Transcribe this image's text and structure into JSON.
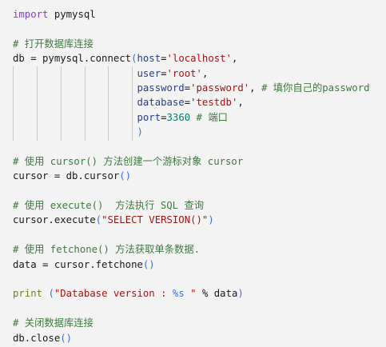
{
  "colors": {
    "background": "#f3f3f3",
    "keyword": "#8a3fc0",
    "comment": "#3f7a3f",
    "string": "#a31515",
    "parameter": "#2a3d8f",
    "number": "#0b7d66",
    "bracket": "#3b6fe0",
    "builtin": "#7a7a28"
  },
  "code": {
    "lines": [
      [
        [
          "kw",
          "import"
        ],
        [
          "tx",
          " pymysql"
        ]
      ],
      [],
      [
        [
          "cm",
          "# 打开数据库连接"
        ]
      ],
      [
        [
          "tx",
          "db = pymysql.connect"
        ],
        [
          "br",
          "("
        ],
        [
          "par",
          "host"
        ],
        [
          "tx",
          "="
        ],
        [
          "str",
          "'localhost'"
        ],
        [
          "tx",
          ","
        ]
      ],
      [
        [
          "tx",
          "                     "
        ],
        [
          "par",
          "user"
        ],
        [
          "tx",
          "="
        ],
        [
          "str",
          "'root'"
        ],
        [
          "tx",
          ","
        ]
      ],
      [
        [
          "tx",
          "                     "
        ],
        [
          "par",
          "password"
        ],
        [
          "tx",
          "="
        ],
        [
          "str",
          "'password'"
        ],
        [
          "tx",
          ", "
        ],
        [
          "cm",
          "# 填你自己的password"
        ]
      ],
      [
        [
          "tx",
          "                     "
        ],
        [
          "par",
          "database"
        ],
        [
          "tx",
          "="
        ],
        [
          "str",
          "'testdb'"
        ],
        [
          "tx",
          ","
        ]
      ],
      [
        [
          "tx",
          "                     "
        ],
        [
          "par",
          "port"
        ],
        [
          "tx",
          "="
        ],
        [
          "num",
          "3360"
        ],
        [
          "tx",
          " "
        ],
        [
          "cm",
          "# 端口"
        ]
      ],
      [
        [
          "tx",
          "                     "
        ],
        [
          "br",
          ")"
        ]
      ],
      [],
      [
        [
          "cm",
          "# 使用 cursor() 方法创建一个游标对象 cursor"
        ]
      ],
      [
        [
          "tx",
          "cursor = db.cursor"
        ],
        [
          "br",
          "()"
        ]
      ],
      [],
      [
        [
          "cm",
          "# 使用 execute()  方法执行 SQL 查询"
        ]
      ],
      [
        [
          "tx",
          "cursor.execute"
        ],
        [
          "br",
          "("
        ],
        [
          "str",
          "\"SELECT VERSION()\""
        ],
        [
          "br",
          ")"
        ]
      ],
      [],
      [
        [
          "cm",
          "# 使用 fetchone() 方法获取单条数据."
        ]
      ],
      [
        [
          "tx",
          "data = cursor.fetchone"
        ],
        [
          "br",
          "()"
        ]
      ],
      [],
      [
        [
          "fn",
          "print"
        ],
        [
          "tx",
          " "
        ],
        [
          "br",
          "("
        ],
        [
          "str",
          "\"Database version : "
        ],
        [
          "br",
          "%s"
        ],
        [
          "str",
          " \""
        ],
        [
          "tx",
          " % data"
        ],
        [
          "br",
          ")"
        ]
      ],
      [],
      [
        [
          "cm",
          "# 关闭数据库连接"
        ]
      ],
      [
        [
          "tx",
          "db.close"
        ],
        [
          "br",
          "()"
        ]
      ]
    ]
  }
}
